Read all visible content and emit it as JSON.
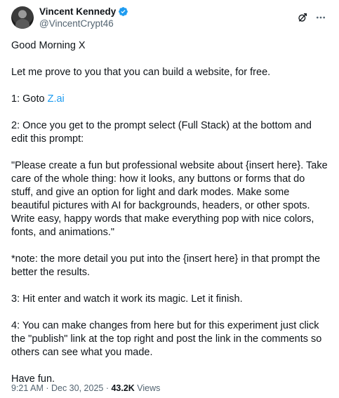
{
  "author": {
    "display_name": "Vincent Kennedy",
    "handle": "@VincentCrypt46"
  },
  "icons": {
    "verified": "verified-badge-icon",
    "grok": "grok-icon",
    "more": "more-icon"
  },
  "colors": {
    "verified": "#1d9bf0",
    "link": "#1d9bf0"
  },
  "post": {
    "p1": "Good Morning X",
    "p2": "Let me prove to you that you can build a website, for free.",
    "p3_prefix": "1: Goto ",
    "p3_link": "Z.ai",
    "p4": "2: Once you get to the prompt select (Full Stack) at the bottom and edit this prompt:",
    "p5": "\"Please create a fun but professional website about {insert here}. Take care of the whole thing: how it looks, any buttons or forms that do stuff, and give an option for light and dark modes. Make some beautiful pictures with AI for backgrounds, headers, or other spots. Write easy, happy words that make everything pop with nice colors, fonts, and animations.\"",
    "p6": "*note: the more detail you put into the {insert here} in that prompt the better the results.",
    "p7": "3: Hit enter and watch it work its magic. Let it finish.",
    "p8": "4: You can make changes from here but for this experiment just click the \"publish\" link at the top right and post the link in the comments so others can see what you made.",
    "p9": "Have fun."
  },
  "meta": {
    "time": "9:21 AM",
    "separator": " · ",
    "date": "Dec 30, 2025",
    "views_count": "43.2K",
    "views_label": " Views"
  }
}
